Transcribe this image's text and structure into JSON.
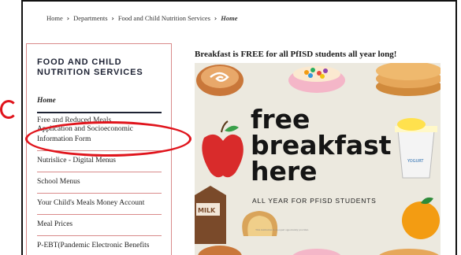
{
  "breadcrumb": {
    "items": [
      "Home",
      "Departments",
      "Food and Child Nutrition Services"
    ],
    "current": "Home",
    "separator": "›"
  },
  "sidebar": {
    "title": "FOOD AND CHILD NUTRITION SERVICES",
    "items": [
      {
        "label": "Home",
        "active": true
      },
      {
        "label_ghost": "Free and Reduced Meals",
        "label": "Application and Socioeconomic Information Form"
      },
      {
        "label": "Nutrislice - Digital Menus"
      },
      {
        "label": "School Menus"
      },
      {
        "label": "Your Child's Meals Money Account"
      },
      {
        "label": "Meal Prices"
      },
      {
        "label": "P-EBT(Pandemic Electronic Benefits"
      }
    ]
  },
  "main": {
    "headline": "Breakfast is FREE for all PfISD students all year long!",
    "poster": {
      "line1": "free",
      "line2": "breakfast",
      "line3": "here",
      "subtitle": "ALL YEAR FOR PFISD STUDENTS",
      "milk_label": "MILK",
      "yogurt_label": "YOGURT",
      "fine_print": "This institution is an equal opportunity provider."
    }
  },
  "colors": {
    "annotation_red": "#e0141c",
    "sidebar_border": "#d98a8a",
    "title_navy": "#1d2233",
    "poster_bg": "#ece9df"
  }
}
